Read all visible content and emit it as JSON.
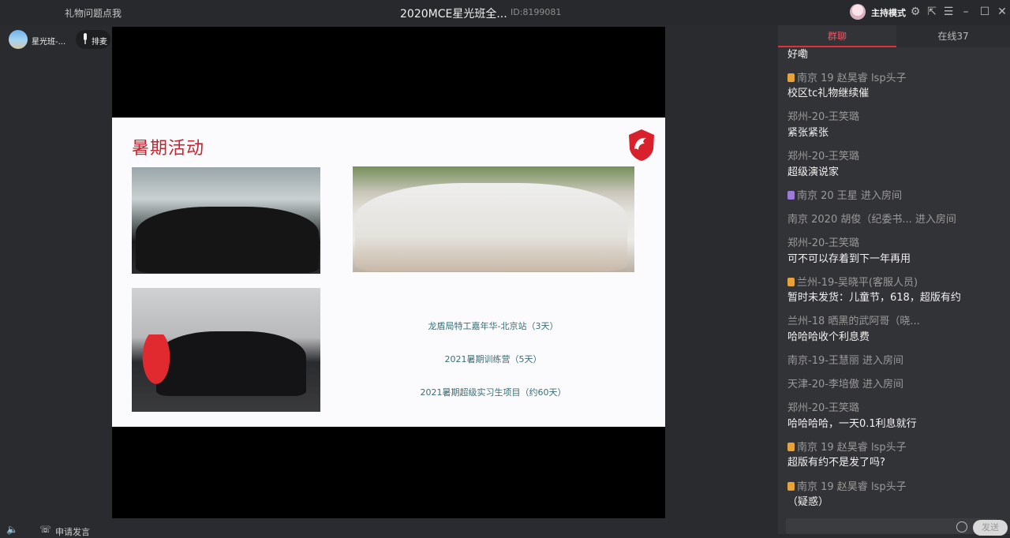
{
  "topbar": {
    "gift_link": "礼物问题点我",
    "title": "2020MCE星光班全...",
    "room_id": "ID:8199081",
    "host_mode": "主持模式"
  },
  "left": {
    "user_name": "星光班-...",
    "mic_label": "排麦",
    "apply_label": "申请发言"
  },
  "slide": {
    "title": "暑期活动",
    "items": [
      "龙盾局特工嘉年华-北京站（3天）",
      "2021暑期训练营（5天）",
      "2021暑期超级实习生项目（约60天）"
    ]
  },
  "chat": {
    "tabs": [
      "群聊",
      "在线37"
    ],
    "messages": [
      {
        "name": "",
        "text": "好嘞"
      },
      {
        "name": "南京 19 赵昊睿 lsp头子",
        "text": "校区tc礼物继续催",
        "badge": "#e8a23a"
      },
      {
        "name": "郑州-20-王笑璐",
        "text": "紧张紧张"
      },
      {
        "name": "郑州-20-王笑璐",
        "text": "超级演说家"
      },
      {
        "name": "南京  20    王星  进入房间",
        "text": "",
        "badge": "#9b7ad8"
      },
      {
        "name": "南京 2020 胡俊（纪委书...  进入房间",
        "text": ""
      },
      {
        "name": "郑州-20-王笑璐",
        "text": "可不可以存着到下一年再用"
      },
      {
        "name": "兰州-19-吴晓平(客服人员)",
        "text": "暂时未发货：儿童节，618，超版有约",
        "badge": "#e8a23a"
      },
      {
        "name": "兰州-18 晒黑的武阿哥（晓...",
        "text": "哈哈哈收个利息费"
      },
      {
        "name": "南京-19-王慧丽  进入房间",
        "text": ""
      },
      {
        "name": "天津-20-李培傲  进入房间",
        "text": ""
      },
      {
        "name": "郑州-20-王笑璐",
        "text": "哈哈哈哈，一天0.1利息就行"
      },
      {
        "name": "南京 19 赵昊睿 lsp头子",
        "text": "超版有约不是发了吗?",
        "badge": "#e8a23a"
      },
      {
        "name": "南京 19 赵昊睿 lsp头子",
        "text": "（疑惑）",
        "badge": "#e8a23a"
      }
    ],
    "send_label": "发送"
  }
}
